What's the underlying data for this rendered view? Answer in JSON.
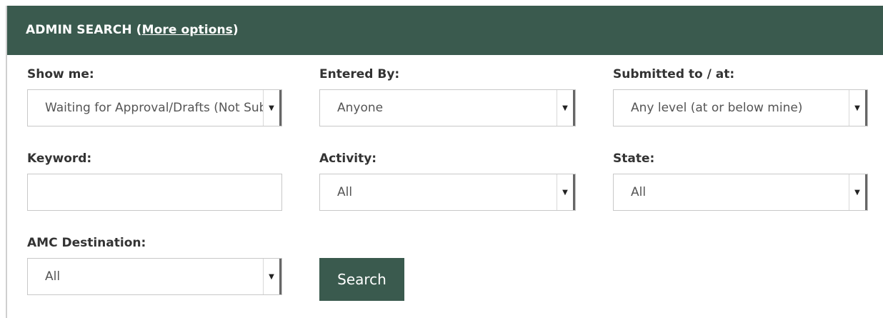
{
  "header": {
    "title": "ADMIN SEARCH (",
    "link": "More options",
    "title_end": ")"
  },
  "fields": {
    "show_me": {
      "label": "Show me:",
      "value": "Waiting for Approval/Drafts (Not Submitted)"
    },
    "entered_by": {
      "label": "Entered By:",
      "value": "Anyone"
    },
    "submitted_to": {
      "label": "Submitted to / at:",
      "value": "Any level (at or below mine)"
    },
    "keyword": {
      "label": "Keyword:",
      "value": "",
      "placeholder": ""
    },
    "activity": {
      "label": "Activity:",
      "value": "All"
    },
    "state": {
      "label": "State:",
      "value": "All"
    },
    "amc_destination": {
      "label": "AMC Destination:",
      "value": "All"
    }
  },
  "search_button": {
    "label": "Search"
  },
  "colors": {
    "header_bg": "#3a5a4e",
    "button_bg": "#3a5a4e"
  }
}
